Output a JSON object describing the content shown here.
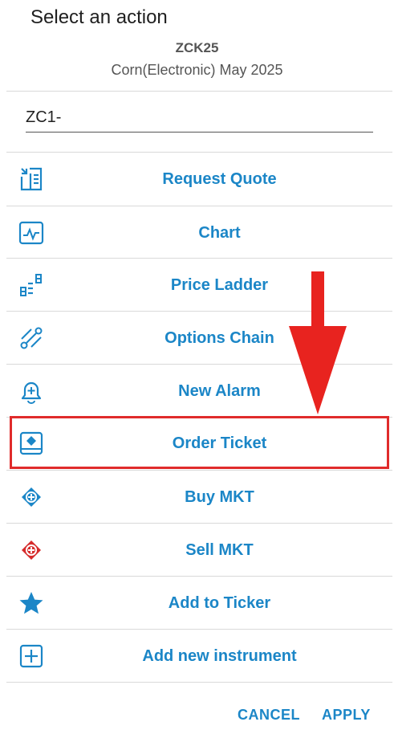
{
  "dialog": {
    "title": "Select an action",
    "symbol": "ZCK25",
    "subtitle": "Corn(Electronic) May 2025"
  },
  "search": {
    "value": "ZC1-"
  },
  "actions": [
    {
      "label": "Request Quote",
      "icon": "request-quote-icon"
    },
    {
      "label": "Chart",
      "icon": "chart-icon"
    },
    {
      "label": "Price Ladder",
      "icon": "price-ladder-icon"
    },
    {
      "label": "Options Chain",
      "icon": "options-chain-icon"
    },
    {
      "label": "New Alarm",
      "icon": "alarm-icon"
    },
    {
      "label": "Order Ticket",
      "icon": "order-ticket-icon"
    },
    {
      "label": "Buy MKT",
      "icon": "buy-icon"
    },
    {
      "label": "Sell MKT",
      "icon": "sell-icon"
    },
    {
      "label": "Add to Ticker",
      "icon": "star-icon"
    },
    {
      "label": "Add new instrument",
      "icon": "plus-box-icon"
    }
  ],
  "footer": {
    "cancel_label": "CANCEL",
    "apply_label": "APPLY"
  },
  "colors": {
    "accent": "#1b86c7",
    "sell": "#d62b2b",
    "highlight": "#e02b2b"
  }
}
